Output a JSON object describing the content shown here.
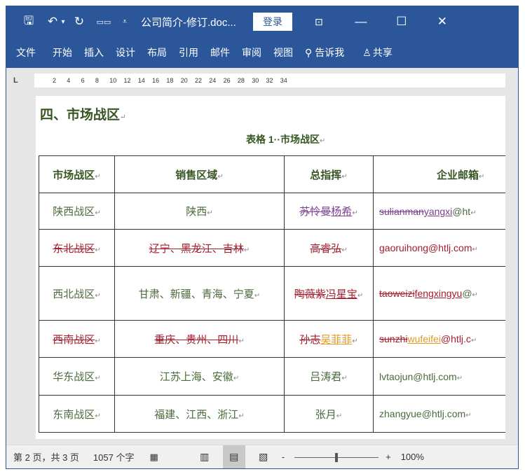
{
  "titlebar": {
    "title": "公司简介-修订.doc...",
    "login": "登录",
    "save_icon": "save-icon",
    "undo_icon": "undo-icon",
    "redo_icon": "redo-icon"
  },
  "ribbon": {
    "tabs": [
      "文件",
      "开始",
      "插入",
      "设计",
      "布局",
      "引用",
      "邮件",
      "审阅",
      "视图"
    ],
    "tell_me": "告诉我",
    "share": "共享"
  },
  "ruler": {
    "corner": "L",
    "ticks": [
      "2",
      "4",
      "6",
      "8",
      "10",
      "12",
      "14",
      "16",
      "18",
      "20",
      "22",
      "24",
      "26",
      "28",
      "30",
      "32",
      "34"
    ]
  },
  "document": {
    "heading": "四、市场战区",
    "caption": "表格 1··市场战区",
    "headers": [
      "市场战区",
      "销售区域",
      "总指挥",
      "企业邮箱"
    ],
    "colors": {
      "normal": "#4b6a3a",
      "deleted_red": "#a31d2c",
      "purple": "#7a3f8f",
      "orange": "#e39a1f"
    },
    "rows": [
      [
        [
          {
            "t": "陕西战区",
            "s": "n"
          }
        ],
        [
          {
            "t": "陕西",
            "s": "n"
          }
        ],
        [
          {
            "t": "苏怜曼",
            "s": "del",
            "c": "purple"
          },
          {
            "t": "杨希",
            "s": "ins",
            "c": "purple"
          }
        ],
        [
          {
            "t": "sulianman",
            "s": "del",
            "c": "purple"
          },
          {
            "t": "yangxi",
            "s": "ins",
            "c": "purple"
          },
          {
            "t": "@ht",
            "s": "n"
          }
        ]
      ],
      [
        [
          {
            "t": "东北战区",
            "s": "del",
            "c": "deleted_red"
          }
        ],
        [
          {
            "t": "辽宁、黑龙江、吉林",
            "s": "del",
            "c": "deleted_red"
          }
        ],
        [
          {
            "t": "高睿弘",
            "s": "del",
            "c": "deleted_red"
          }
        ],
        [
          {
            "t": "gaoruihong@htlj.com",
            "s": "n",
            "c": "deleted_red"
          }
        ]
      ],
      [
        [
          {
            "t": "西北战区",
            "s": "n"
          }
        ],
        [
          {
            "t": "甘肃、新疆、青海、宁夏",
            "s": "n"
          }
        ],
        [
          {
            "t": "陶薇紫",
            "s": "del",
            "c": "deleted_red"
          },
          {
            "t": "冯星宝",
            "s": "ins",
            "c": "deleted_red"
          }
        ],
        [
          {
            "t": "taoweizi",
            "s": "del",
            "c": "deleted_red"
          },
          {
            "t": "fengxingyu",
            "s": "ins",
            "c": "deleted_red"
          },
          {
            "t": "@",
            "s": "n"
          }
        ]
      ],
      [
        [
          {
            "t": "西南战区",
            "s": "del",
            "c": "deleted_red"
          }
        ],
        [
          {
            "t": "重庆、贵州、四川",
            "s": "del",
            "c": "deleted_red"
          }
        ],
        [
          {
            "t": "孙志",
            "s": "del",
            "c": "deleted_red"
          },
          {
            "t": "吴菲菲",
            "s": "ins",
            "c": "orange"
          }
        ],
        [
          {
            "t": "sunzhi",
            "s": "del",
            "c": "deleted_red"
          },
          {
            "t": "wufeifei",
            "s": "ins",
            "c": "orange"
          },
          {
            "t": "@htlj.c",
            "s": "n",
            "c": "deleted_red"
          }
        ]
      ],
      [
        [
          {
            "t": "华东战区",
            "s": "n"
          }
        ],
        [
          {
            "t": "江苏上海、安徽",
            "s": "n"
          }
        ],
        [
          {
            "t": "吕涛君",
            "s": "n"
          }
        ],
        [
          {
            "t": "lvtaojun@htlj.com",
            "s": "n"
          }
        ]
      ],
      [
        [
          {
            "t": "东南战区",
            "s": "n"
          }
        ],
        [
          {
            "t": "福建、江西、浙江",
            "s": "n"
          }
        ],
        [
          {
            "t": "张月",
            "s": "n"
          }
        ],
        [
          {
            "t": "zhangyue@htlj.com",
            "s": "n"
          }
        ]
      ]
    ]
  },
  "status": {
    "page": "第 2 页，共 3 页",
    "words": "1057 个字",
    "zoom_minus": "-",
    "zoom_plus": "+",
    "zoom": "100%",
    "zoom_level_percent": 100
  }
}
